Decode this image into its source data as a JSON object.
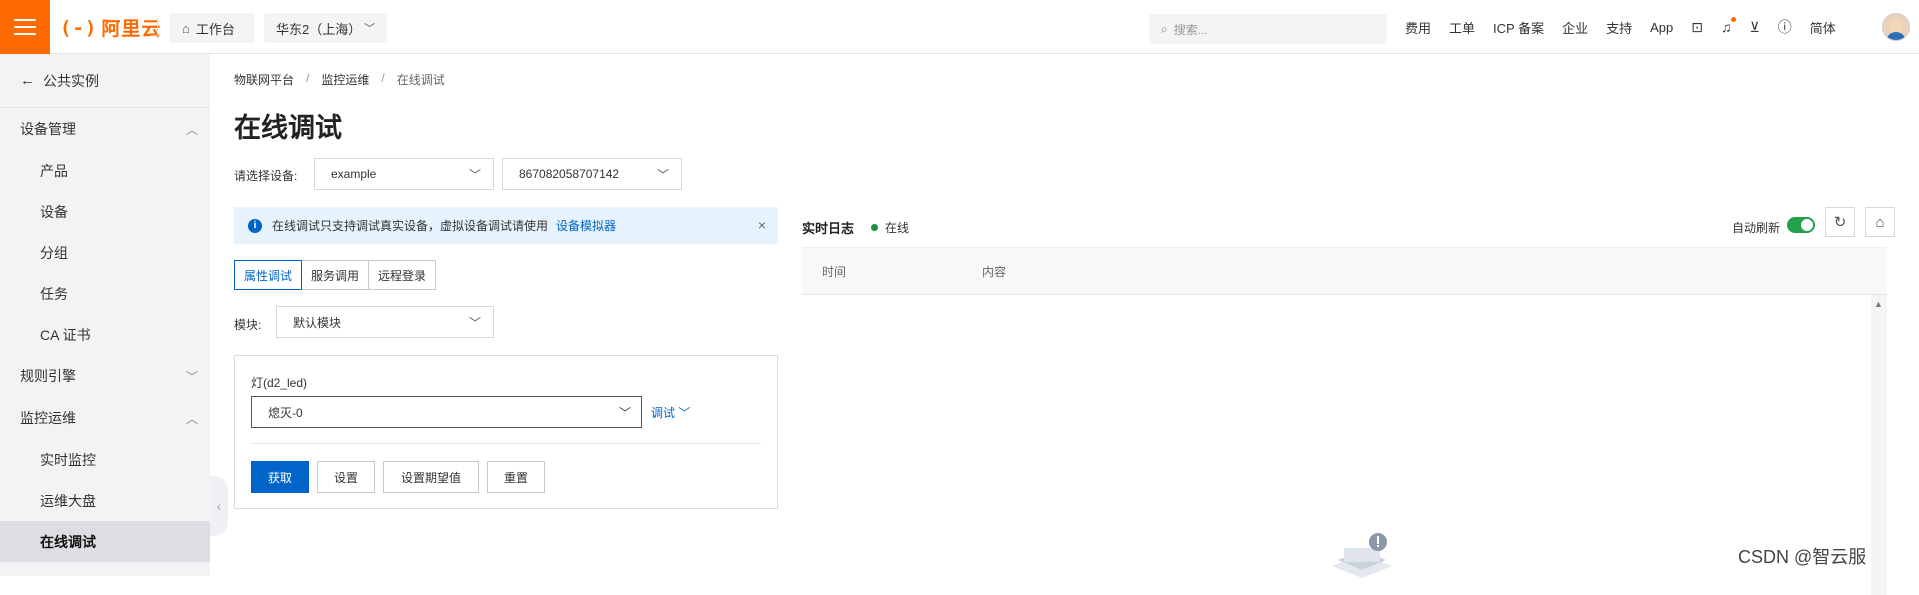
{
  "topbar": {
    "logo_text": "阿里云",
    "workbench": "工作台",
    "region": "华东2（上海）",
    "search_placeholder": "搜索...",
    "links": [
      "费用",
      "工单",
      "ICP 备案",
      "企业",
      "支持",
      "App"
    ],
    "language": "简体"
  },
  "sidebar": {
    "back": "公共实例",
    "groups": [
      {
        "label": "设备管理",
        "items": [
          "产品",
          "设备",
          "分组",
          "任务",
          "CA 证书"
        ]
      },
      {
        "label": "规则引擎",
        "items": []
      },
      {
        "label": "监控运维",
        "items": [
          "实时监控",
          "运维大盘",
          "在线调试"
        ]
      }
    ],
    "active": "在线调试"
  },
  "breadcrumb": [
    "物联网平台",
    "监控运维",
    "在线调试"
  ],
  "page_title": "在线调试",
  "device_select": {
    "label": "请选择设备:",
    "product": "example",
    "device": "867082058707142"
  },
  "notice": {
    "text": "在线调试只支持调试真实设备，虚拟设备调试请使用",
    "link": "设备模拟器"
  },
  "tabs": [
    "属性调试",
    "服务调用",
    "远程登录"
  ],
  "module": {
    "label": "模块:",
    "value": "默认模块"
  },
  "property": {
    "label": "灯(d2_led)",
    "value": "熄灭-0",
    "debug_link": "调试"
  },
  "actions": [
    "获取",
    "设置",
    "设置期望值",
    "重置"
  ],
  "log": {
    "title": "实时日志",
    "status": "在线",
    "auto_refresh_label": "自动刷新",
    "auto_refresh": true,
    "columns": [
      "时间",
      "内容"
    ]
  },
  "watermark": "CSDN @智云服",
  "colors": {
    "brand": "#ff6a00",
    "primary": "#0064c8",
    "online": "#1e8e3e",
    "toggle_on": "#23a04b"
  }
}
